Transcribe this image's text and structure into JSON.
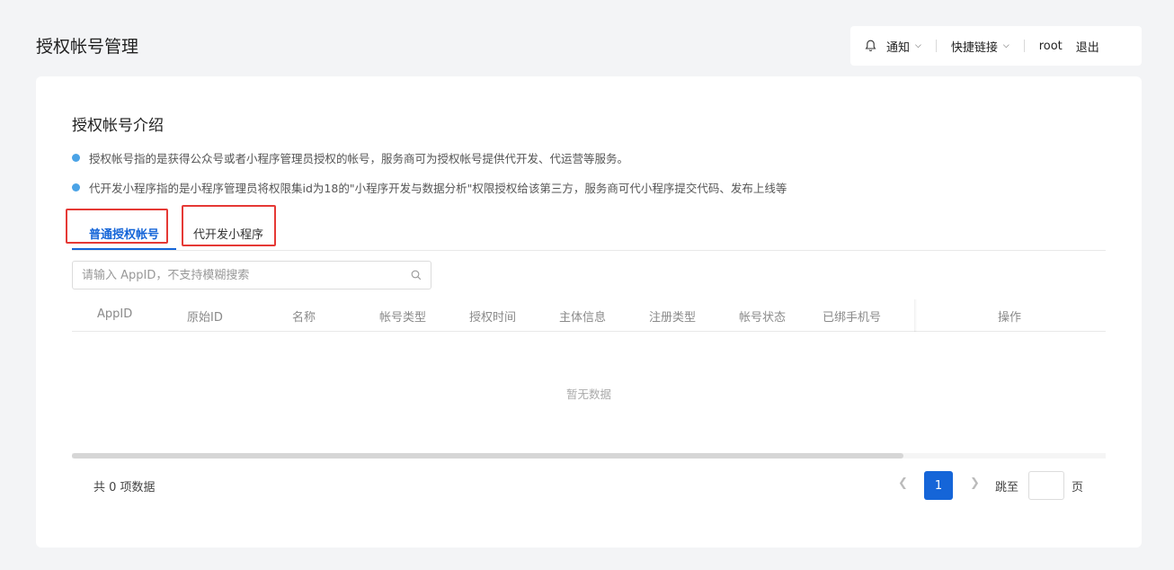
{
  "header": {
    "title": "授权帐号管理",
    "notify_label": "通知",
    "quicklinks_label": "快捷链接",
    "user": "root",
    "logout_label": "退出"
  },
  "intro": {
    "title": "授权帐号介绍",
    "bullets": [
      "授权帐号指的是获得公众号或者小程序管理员授权的帐号，服务商可为授权帐号提供代开发、代运营等服务。",
      "代开发小程序指的是小程序管理员将权限集id为18的\"小程序开发与数据分析\"权限授权给该第三方，服务商可代小程序提交代码、发布上线等"
    ]
  },
  "tabs": [
    {
      "label": "普通授权帐号",
      "active": true
    },
    {
      "label": "代开发小程序",
      "active": false
    }
  ],
  "search": {
    "placeholder": "请输入 AppID，不支持模糊搜索"
  },
  "table": {
    "columns": [
      "AppID",
      "原始ID",
      "名称",
      "帐号类型",
      "授权时间",
      "主体信息",
      "注册类型",
      "帐号状态",
      "已绑手机号",
      "操作"
    ],
    "empty_text": "暂无数据"
  },
  "pagination": {
    "total_text": "共 0 项数据",
    "current_page": "1",
    "jump_label": "跳至",
    "page_suffix": "页"
  },
  "colors": {
    "accent": "#1565d8",
    "bullet": "#4aa3e6",
    "highlight_box": "#e53935"
  }
}
